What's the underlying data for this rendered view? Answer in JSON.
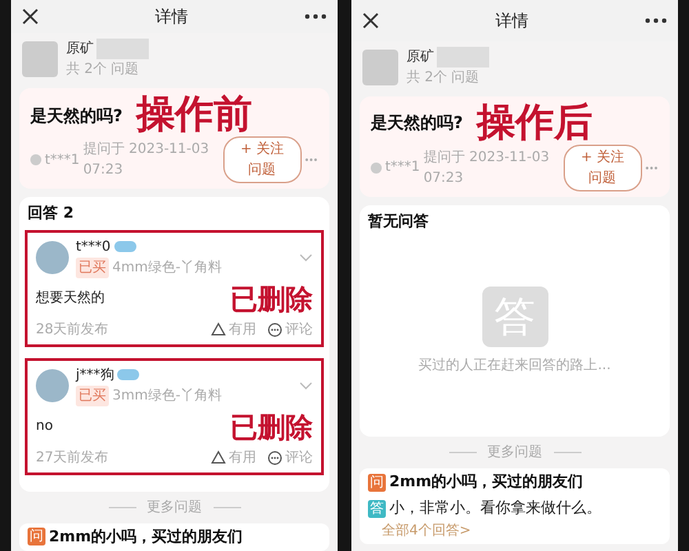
{
  "panels": [
    {
      "kind": "answers",
      "nav_title": "详情",
      "product": {
        "name": "原矿",
        "count": "共 2个 问题"
      },
      "question": "是天然的吗?",
      "stamp": "操作前",
      "asker": "t***1",
      "asked_at": "提问于 2023-11-03 07:23",
      "follow": "+ 关注问题",
      "section_title": "回答 2",
      "answers": [
        {
          "user": "t***0",
          "tag": "已买",
          "spec": "4mm绿色-丫角料",
          "text": "想要天然的",
          "time": "28天前发布",
          "useful": "有用",
          "comment": "评论",
          "stamp": "已删除",
          "highlighted": true
        },
        {
          "user": "j***狗",
          "tag": "已买",
          "spec": "3mm绿色-丫角料",
          "text": "no",
          "time": "27天前发布",
          "useful": "有用",
          "comment": "评论",
          "stamp": "已删除",
          "highlighted": true
        }
      ],
      "more": "更多问题",
      "related": {
        "q_mark": "问",
        "question": "2mm的小吗，买过的朋友们"
      }
    },
    {
      "kind": "empty",
      "nav_title": "详情",
      "product": {
        "name": "原矿",
        "count": "共 2个 问题"
      },
      "question": "是天然的吗?",
      "stamp": "操作后",
      "asker": "t***1",
      "asked_at": "提问于 2023-11-03 07:23",
      "follow": "+ 关注问题",
      "section_title": "暂无问答",
      "empty_mark": "答",
      "empty_message": "买过的人正在赶来回答的路上...",
      "more": "更多问题",
      "related": {
        "q_mark": "问",
        "question": "2mm的小吗，买过的朋友们",
        "a_mark": "答",
        "answer": "小，非常小。看你拿来做什么。",
        "all_link": "全部4个回答>"
      }
    }
  ]
}
